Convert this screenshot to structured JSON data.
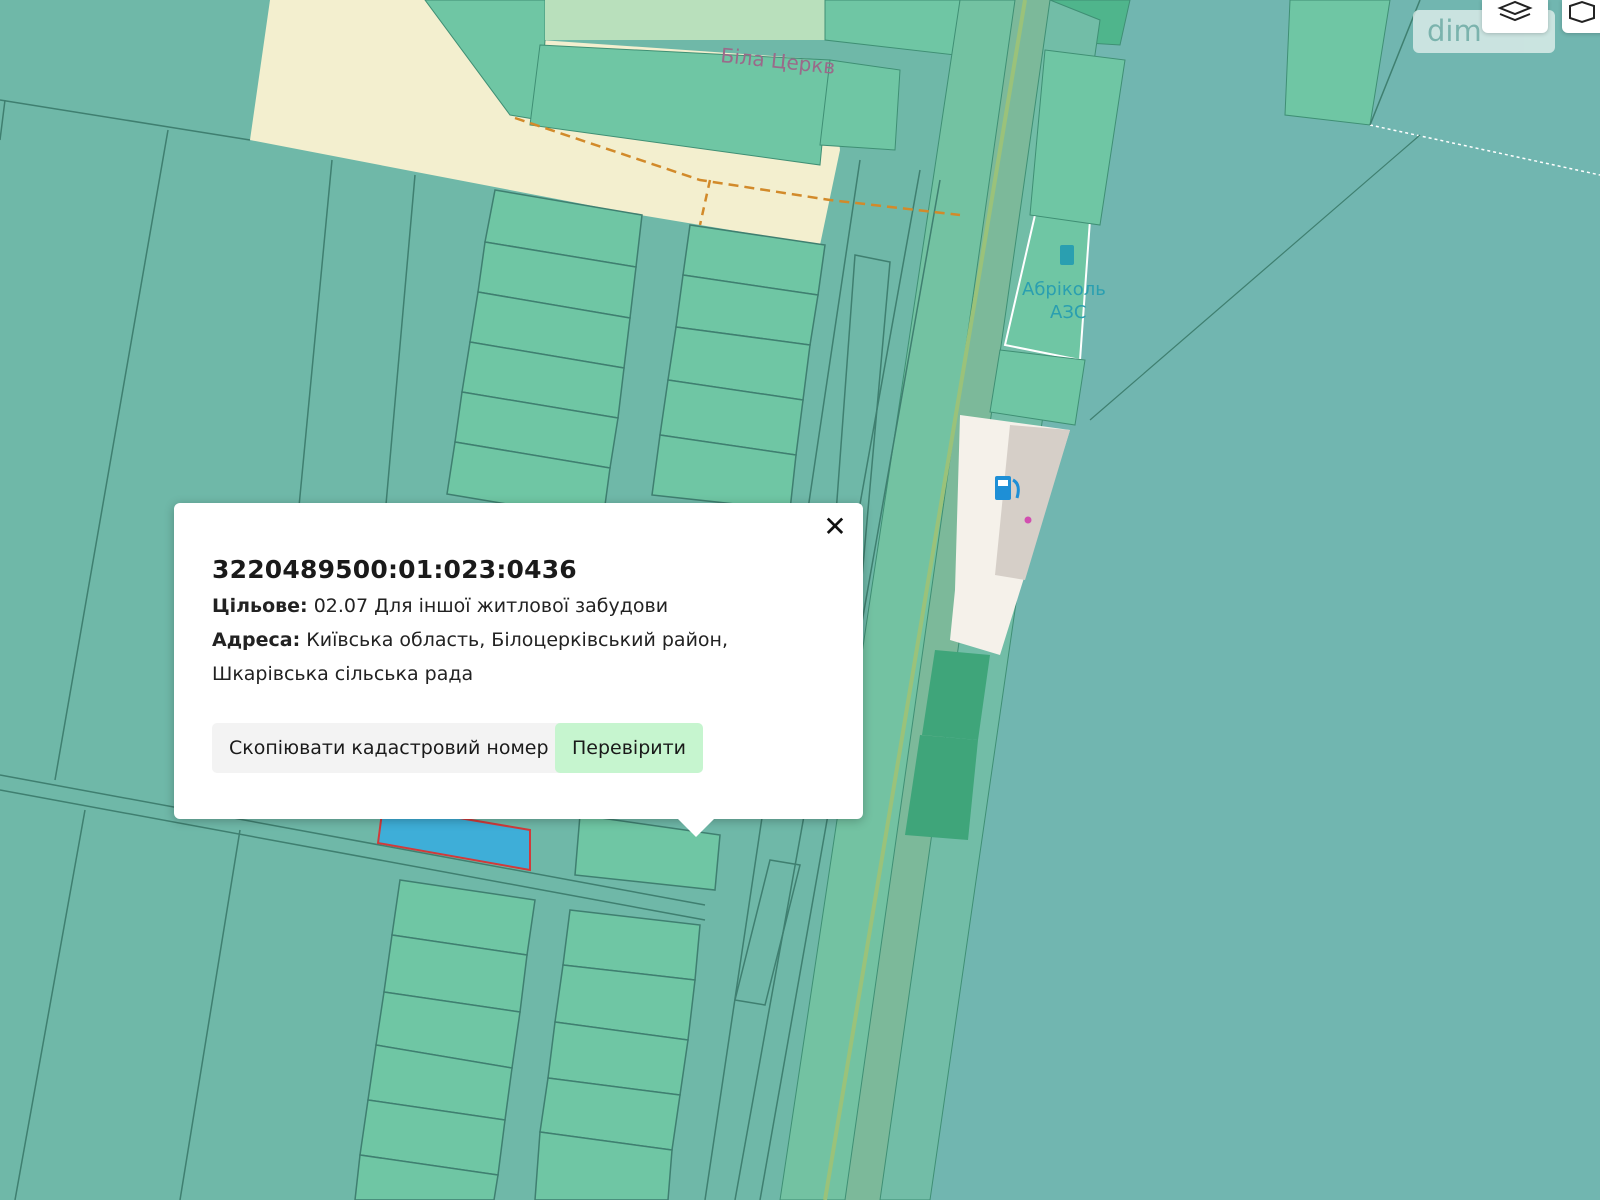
{
  "map": {
    "street_label": "Біла Церкв",
    "poi_label_line1": "Абріколь",
    "poi_label_line2": "АЗС",
    "colors": {
      "parcel_green": "#6fc6a4",
      "parcel_teal": "#6fb8a8",
      "road_green": "#7cb99a",
      "highlight_parcel": "#3eaed8",
      "urban_area": "#f3efcf",
      "fuel_blue": "#1e8fd6"
    }
  },
  "logo": {
    "text": "dim"
  },
  "popup": {
    "cadastral_number": "3220489500:01:023:0436",
    "purpose_label": "Цільове:",
    "purpose_value": "02.07 Для іншої житлової забудови",
    "address_label": "Адреса:",
    "address_value": "Київська область, Білоцерківський район, Шкарівська сільська рада",
    "copy_button": "Скопіювати кадастровий номер",
    "check_button": "Перевірити",
    "close_icon": "close-icon"
  }
}
